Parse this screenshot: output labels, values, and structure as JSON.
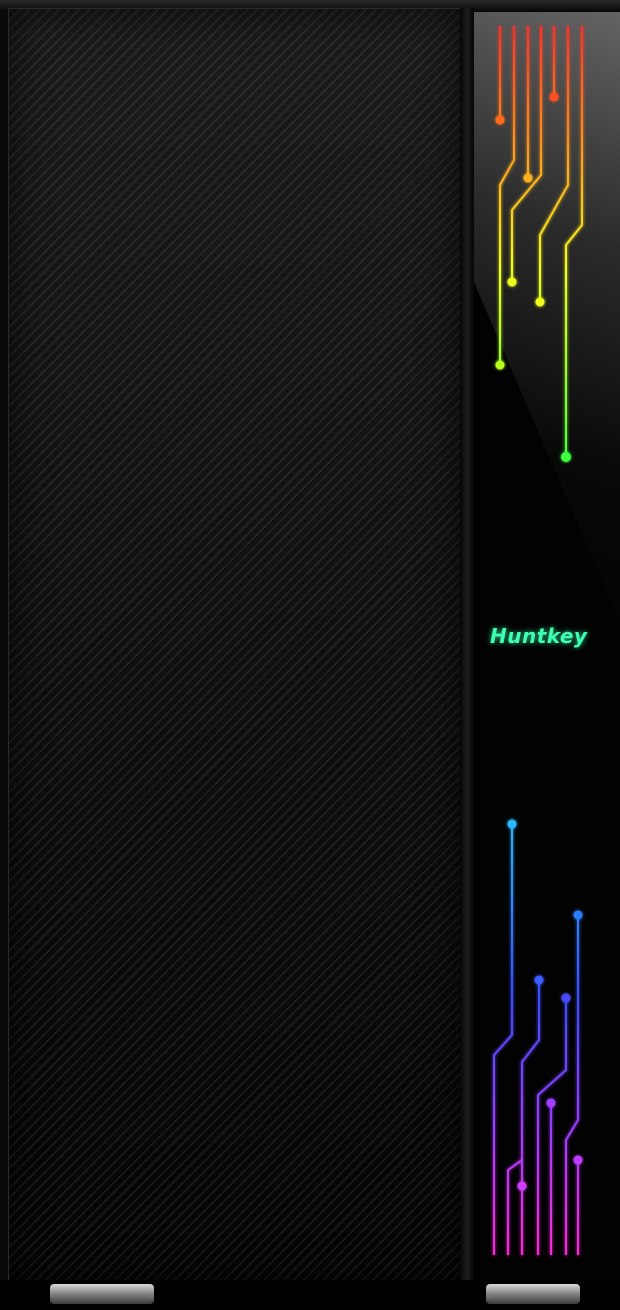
{
  "logo": {
    "text": "Huntkey"
  },
  "colors": {
    "logo": "#3dffb0",
    "trace_top_red": "#ff2a2a",
    "trace_top_green": "#3dff3d",
    "trace_bottom_blue": "#2a8cff",
    "trace_bottom_magenta": "#e040ff"
  }
}
